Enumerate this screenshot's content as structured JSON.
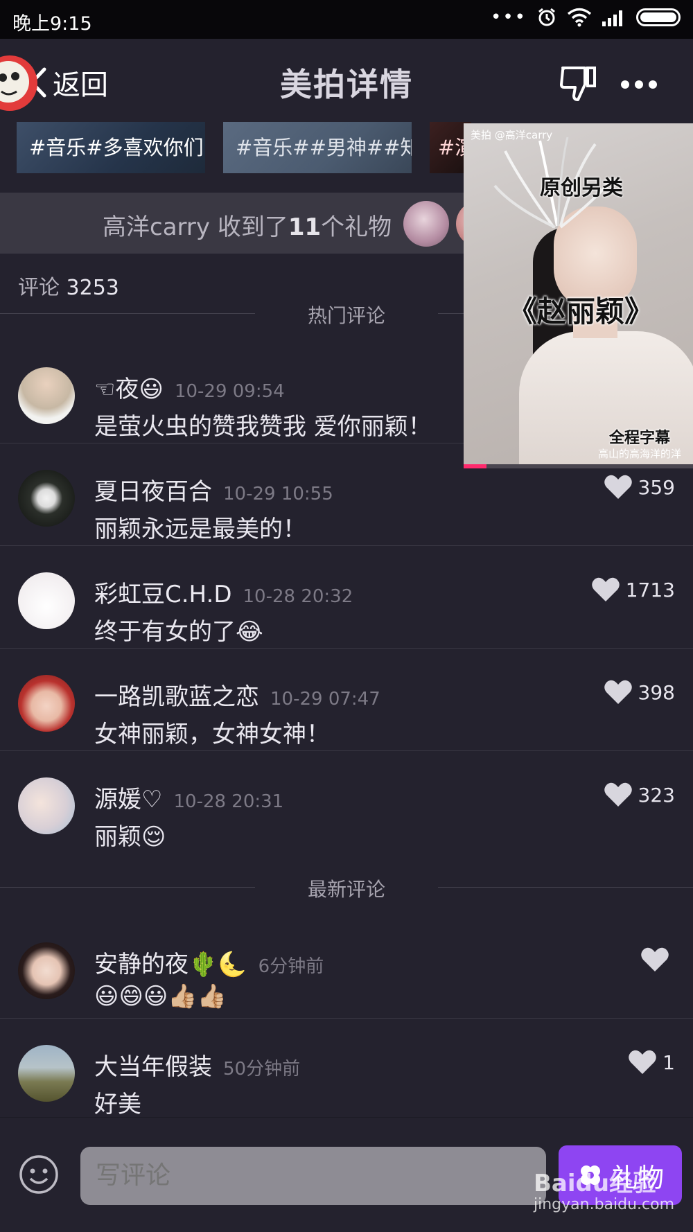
{
  "status_bar": {
    "time": "晚上9:15",
    "dots": "•••"
  },
  "header": {
    "back_label": "返回",
    "title": "美拍详情"
  },
  "tags": [
    "#音乐#多喜欢你们",
    "#音乐##男神##知",
    "#演"
  ],
  "gift_bar": {
    "user": "高洋carry",
    "text_pre": " 收到了",
    "count": "11",
    "text_post": "个礼物"
  },
  "comments": {
    "label": "评论",
    "count": "3253",
    "hot_title": "热门评论",
    "latest_title": "最新评论",
    "hot": [
      {
        "name": "☜夜😃",
        "time": "10-29 09:54",
        "text": "是萤火虫的赞我赞我 爱你丽颖！",
        "likes": ""
      },
      {
        "name": "夏日夜百合",
        "time": "10-29 10:55",
        "text": "丽颖永远是最美的！",
        "likes": "359"
      },
      {
        "name": "彩虹豆C.H.D",
        "time": "10-28 20:32",
        "text": "终于有女的了😂",
        "likes": "1713"
      },
      {
        "name": "一路凯歌蓝之恋",
        "time": "10-29 07:47",
        "text": "女神丽颖，女神女神！",
        "likes": "398"
      },
      {
        "name": "源媛♡",
        "time": "10-28 20:31",
        "text": "丽颖😌",
        "likes": "323"
      }
    ],
    "latest": [
      {
        "name": "安静的夜🌵🌜",
        "time": "6分钟前",
        "text": "😃😄😃👍🏼👍🏼",
        "likes": ""
      },
      {
        "name": "大当年假装",
        "time": "50分钟前",
        "text": "好美",
        "likes": "1"
      }
    ]
  },
  "video": {
    "brand": "美拍 @高洋carry",
    "line1": "原创另类",
    "line2": "《赵丽颖》",
    "line3": "全程字幕",
    "line4": "高山的高海洋的洋",
    "progress": 0.1
  },
  "bottom": {
    "placeholder": "写评论",
    "gift_label": "礼物"
  },
  "watermark": {
    "brand": "Baidu经验",
    "url": "jingyan.baidu.com"
  },
  "colors": {
    "accent": "#8e45f2",
    "progress": "#ff2a6d",
    "background": "#24222e"
  },
  "icons": [
    "back-chevron-icon",
    "dislike-icon",
    "more-icon",
    "heart-icon",
    "emoji-icon",
    "gift-icon"
  ]
}
